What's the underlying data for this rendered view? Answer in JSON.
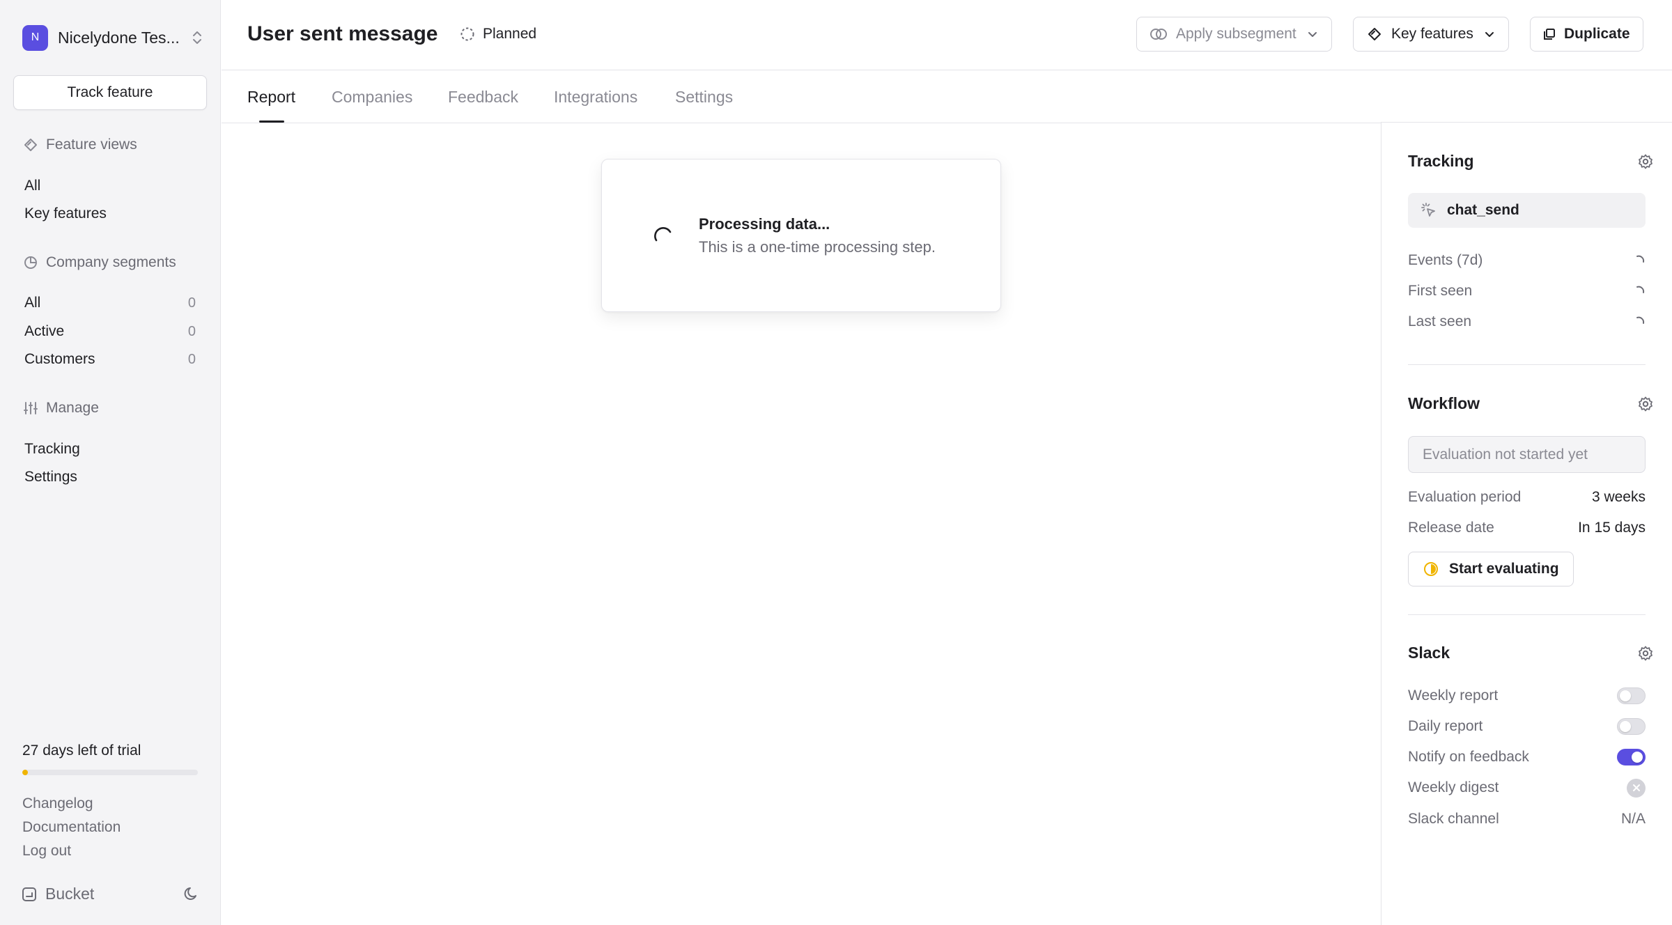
{
  "sidebar": {
    "org_initial": "N",
    "org_name": "Nicelydone Tes...",
    "track_feature_label": "Track feature",
    "feature_views": {
      "heading": "Feature views",
      "items": [
        {
          "label": "All"
        },
        {
          "label": "Key features"
        }
      ]
    },
    "company_segments": {
      "heading": "Company segments",
      "items": [
        {
          "label": "All",
          "count": "0"
        },
        {
          "label": "Active",
          "count": "0"
        },
        {
          "label": "Customers",
          "count": "0"
        }
      ]
    },
    "manage": {
      "heading": "Manage",
      "items": [
        {
          "label": "Tracking"
        },
        {
          "label": "Settings"
        }
      ]
    },
    "trial_text": "27 days left of trial",
    "trial_progress": 0.03,
    "links": [
      {
        "label": "Changelog"
      },
      {
        "label": "Documentation"
      },
      {
        "label": "Log out"
      }
    ],
    "brand": "Bucket"
  },
  "header": {
    "title": "User sent message",
    "status": "Planned",
    "apply_subsegment_label": "Apply subsegment",
    "key_features_label": "Key features",
    "duplicate_label": "Duplicate"
  },
  "tabs": [
    {
      "label": "Report",
      "active": true
    },
    {
      "label": "Companies",
      "active": false
    },
    {
      "label": "Feedback",
      "active": false
    },
    {
      "label": "Integrations",
      "active": false
    },
    {
      "label": "Settings",
      "active": false
    }
  ],
  "main": {
    "processing_title": "Processing data...",
    "processing_subtitle": "This is a one-time processing step."
  },
  "panel": {
    "tracking": {
      "heading": "Tracking",
      "event": "chat_send",
      "rows": [
        {
          "label": "Events (7d)"
        },
        {
          "label": "First seen"
        },
        {
          "label": "Last seen"
        }
      ]
    },
    "workflow": {
      "heading": "Workflow",
      "evaluation_status": "Evaluation not started yet",
      "evaluation_period_label": "Evaluation period",
      "evaluation_period_value": "3 weeks",
      "release_date_label": "Release date",
      "release_date_value": "In 15 days",
      "start_label": "Start evaluating"
    },
    "slack": {
      "heading": "Slack",
      "weekly_report_label": "Weekly report",
      "weekly_report_on": false,
      "daily_report_label": "Daily report",
      "daily_report_on": false,
      "notify_feedback_label": "Notify on feedback",
      "notify_feedback_on": true,
      "weekly_digest_label": "Weekly digest",
      "slack_channel_label": "Slack channel",
      "slack_channel_value": "N/A"
    }
  },
  "colors": {
    "accent": "#5a4ee0",
    "trial_bar": "#f0b400",
    "evaluating_icon": "#f0b400"
  }
}
